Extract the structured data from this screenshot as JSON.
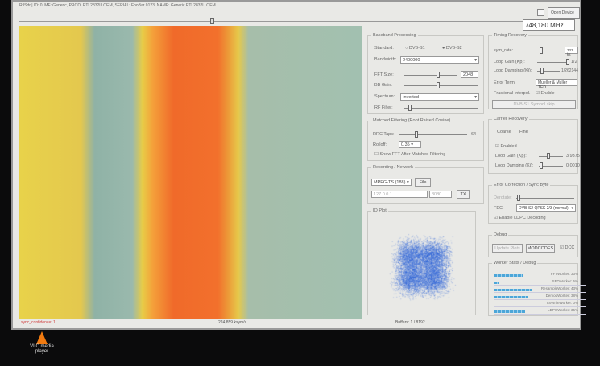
{
  "window": {
    "title": "RtlSdr | ID: 0, MF: Generic, PROD: RTL2832U OEM, SERIAL: FooBar 0123, NAME: Generic RTL2832U OEM",
    "open_device": "Open Device",
    "frequency": "748,180 MHz"
  },
  "baseband": {
    "legend": "Baseband Processing",
    "standard_label": "Standard:",
    "opt1": "DVB-S1",
    "opt2": "DVB-S2",
    "selected": "DVB-S2",
    "bandwidth_label": "Bandwidth:",
    "bandwidth": "2400000",
    "fft_label": "FFT Size:",
    "fft": "2048",
    "bb_gain_label": "BB Gain:",
    "spectrum_label": "Spectrum:",
    "spectrum": "Inverted",
    "rf_filter_label": "RF Filter:"
  },
  "timing": {
    "legend": "Timing Recovery",
    "sym_rate_label": "sym_rate:",
    "sym_rate": "333 ks",
    "loop_gain_label": "Loop Gain (Kp):",
    "loop_gain": "1/2",
    "loop_damp_label": "Loop Damping (Ki):",
    "loop_damp": "1/262144",
    "error_term_label": "Error Term:",
    "error_term": "Mueller & Muller TED",
    "frac_label": "Fractional Interpol.",
    "frac_enable": "Enable",
    "symbol_skip": "DVB-S1 Symbol skip"
  },
  "matched": {
    "legend": "Matched Filtering (Root Raised Cosine)",
    "taps_label": "RRC Taps:",
    "taps": "64",
    "rolloff_label": "Rolloff:",
    "rolloff": "0.35",
    "show_fft": "Show FFT After Matched Filtering"
  },
  "recording": {
    "legend": "Recording / Network",
    "format": "MPEG-TS (188)",
    "file": "File",
    "ip": "127.0.0.1",
    "port": "8080",
    "tx": "TX"
  },
  "carrier": {
    "legend": "Carrier Recovery",
    "coarse": "Coarse",
    "fine": "Fine",
    "enabled": "Enabled",
    "loop_gain_label": "Loop Gain (Kp):",
    "loop_gain": "3.9375",
    "loop_damp_label": "Loop Damping (Ki):",
    "loop_damp": "0.0010"
  },
  "fec": {
    "legend": "Error Correction / Sync Byte",
    "derotate": "Derotate:",
    "fec_label": "FEC:",
    "fec": "DVB-S2 QPSK 2/3 (normal)",
    "ldpc": "Enable LDPC Decoding"
  },
  "iq": {
    "legend": "IQ Plot"
  },
  "debug": {
    "legend": "Debug",
    "update": "Update Plots",
    "modcodes": "MODCODES",
    "dcc": "DCC"
  },
  "workers": {
    "legend": "Worker Stats / Debug",
    "items": [
      {
        "label": "FFTWorker: 33%",
        "pct": 33
      },
      {
        "label": "SFDWorker: 5%",
        "pct": 5
      },
      {
        "label": "ResampleWorker: 43%",
        "pct": 43
      },
      {
        "label": "DemodWorker: 38%",
        "pct": 38
      },
      {
        "label": "TSWriteWorker: 0%",
        "pct": 0
      },
      {
        "label": "LDPCWorker: 35%",
        "pct": 35
      }
    ]
  },
  "status": {
    "sync": "sync_confidence: 1",
    "rate": "224,859 ksym/s",
    "buffers": "Buffers: 1 / 8192"
  },
  "desktop": {
    "vlc_label": "VLC media player"
  },
  "colors": {
    "accent": "#2a62d8",
    "status_red": "#d04040"
  }
}
